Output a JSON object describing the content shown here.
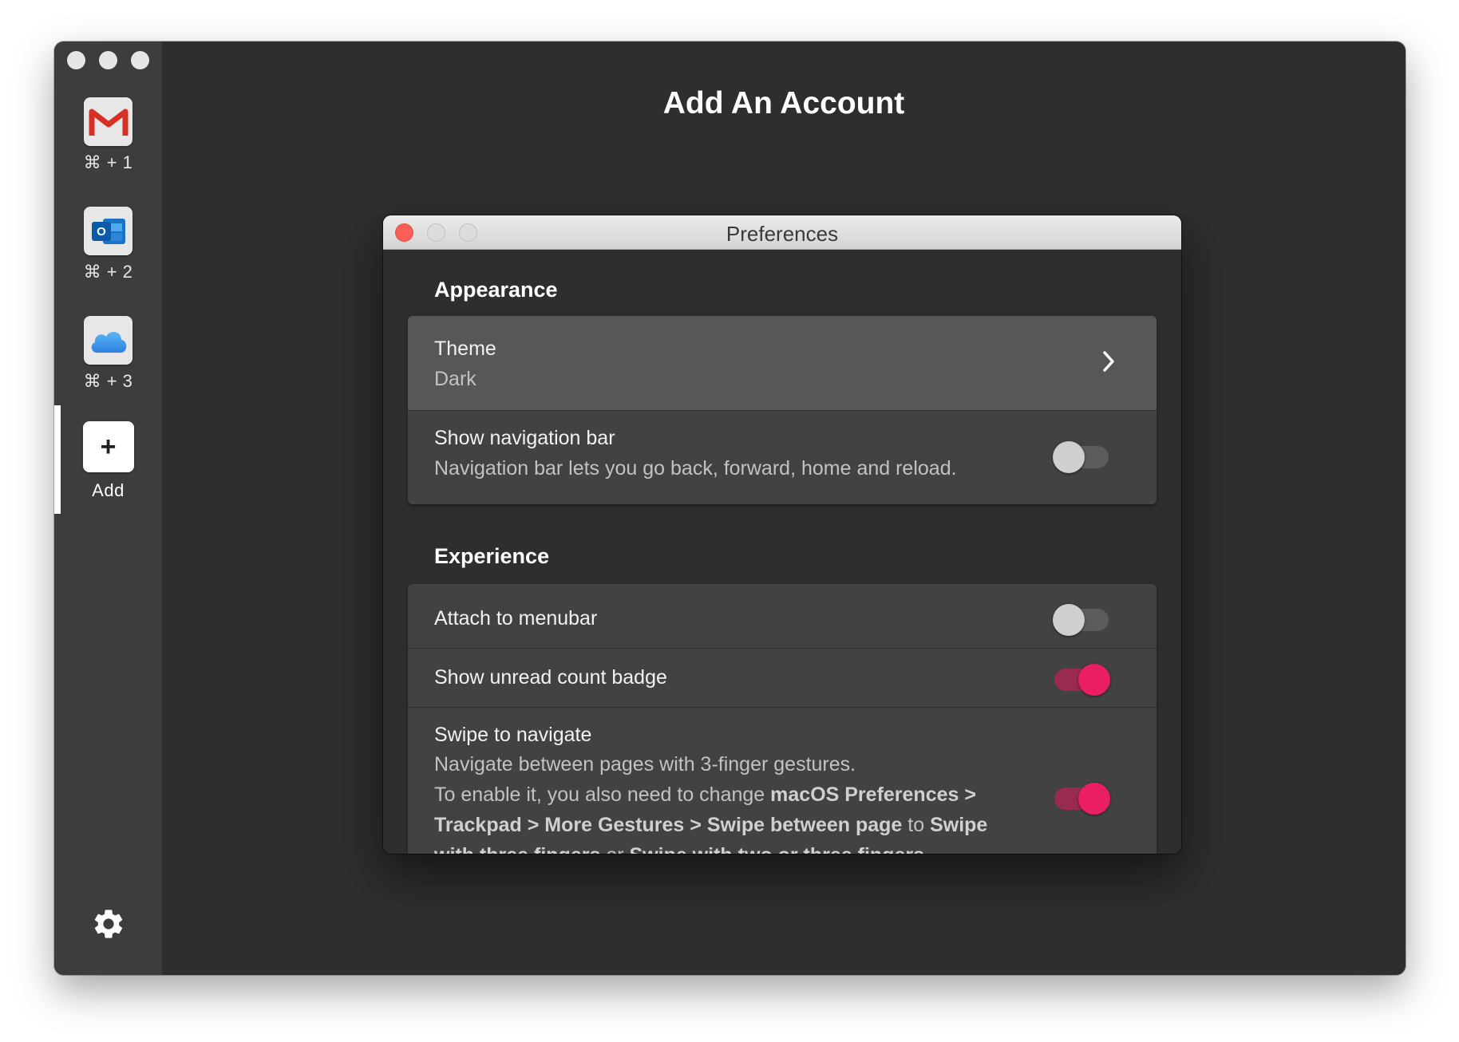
{
  "main": {
    "title": "Add An Account"
  },
  "sidebar": {
    "accounts": [
      {
        "service": "Gmail",
        "icon": "gmail-icon",
        "shortcut": "⌘ + 1"
      },
      {
        "service": "Outlook",
        "icon": "outlook-icon",
        "shortcut": "⌘ + 2"
      },
      {
        "service": "iCloud",
        "icon": "icloud-icon",
        "shortcut": "⌘ + 3"
      }
    ],
    "add": {
      "symbol": "+",
      "label": "Add"
    },
    "settings_icon": "gear-icon"
  },
  "preferences": {
    "window_title": "Preferences",
    "appearance": {
      "heading": "Appearance",
      "theme": {
        "label": "Theme",
        "value": "Dark"
      },
      "nav_bar": {
        "label": "Show navigation bar",
        "description": "Navigation bar lets you go back, forward, home and reload.",
        "enabled": false
      }
    },
    "experience": {
      "heading": "Experience",
      "menubar": {
        "label": "Attach to menubar",
        "enabled": false
      },
      "unread": {
        "label": "Show unread count badge",
        "enabled": true
      },
      "swipe": {
        "label": "Swipe to navigate",
        "line1": "Navigate between pages with 3-finger gestures.",
        "line2_prefix": "To enable it, you also need to change ",
        "line2_bold1": "macOS Preferences > Trackpad > More Gestures > Swipe between page",
        "line2_mid": " to ",
        "line2_bold2": "Swipe with three fingers",
        "line2_mid2": " or ",
        "line2_bold3": "Swipe with two or three fingers",
        "enabled": true
      }
    }
  },
  "colors": {
    "accent": "#e91e63",
    "window_bg": "#2e2e2e",
    "sidebar_bg": "#3d3d3d",
    "card_bg": "#424242"
  }
}
